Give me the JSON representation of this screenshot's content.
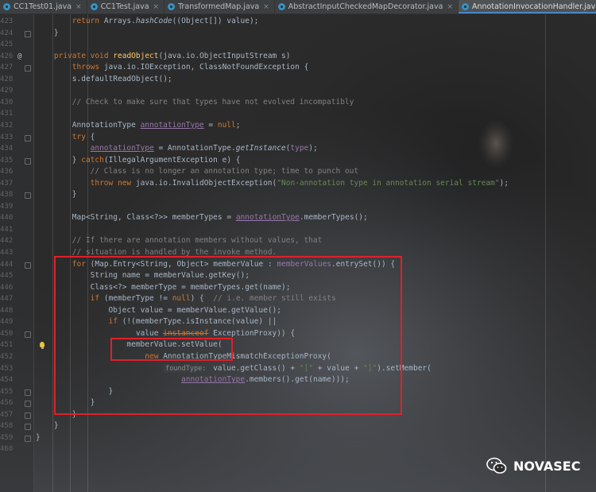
{
  "tabs": [
    {
      "label": "CC1Test01.java",
      "icon": "class-icon"
    },
    {
      "label": "CC1Test.java",
      "icon": "class-icon"
    },
    {
      "label": "TransformedMap.java",
      "icon": "class-icon"
    },
    {
      "label": "AbstractInputCheckedMapDecorator.java",
      "icon": "class-icon"
    },
    {
      "label": "AnnotationInvocationHandler.java",
      "icon": "class-icon",
      "active": true
    }
  ],
  "lines": [
    {
      "n": "423",
      "t": "        return Arrays.hashCode((Object[]) value);"
    },
    {
      "n": "424",
      "t": "    }"
    },
    {
      "n": "425",
      "t": ""
    },
    {
      "n": "426",
      "t": "    private void readObject(java.io.ObjectInputStream s)",
      "mark": "@"
    },
    {
      "n": "427",
      "t": "        throws java.io.IOException, ClassNotFoundException {"
    },
    {
      "n": "428",
      "t": "        s.defaultReadObject();"
    },
    {
      "n": "429",
      "t": ""
    },
    {
      "n": "430",
      "t": "        // Check to make sure that types have not evolved incompatibly"
    },
    {
      "n": "431",
      "t": ""
    },
    {
      "n": "432",
      "t": "        AnnotationType annotationType = null;"
    },
    {
      "n": "433",
      "t": "        try {"
    },
    {
      "n": "434",
      "t": "            annotationType = AnnotationType.getInstance(type);"
    },
    {
      "n": "435",
      "t": "        } catch(IllegalArgumentException e) {"
    },
    {
      "n": "436",
      "t": "            // Class is no longer an annotation type; time to punch out"
    },
    {
      "n": "437",
      "t": "            throw new java.io.InvalidObjectException(\"Non-annotation type in annotation serial stream\");"
    },
    {
      "n": "438",
      "t": "        }"
    },
    {
      "n": "439",
      "t": ""
    },
    {
      "n": "440",
      "t": "        Map<String, Class<?>> memberTypes = annotationType.memberTypes();"
    },
    {
      "n": "441",
      "t": ""
    },
    {
      "n": "442",
      "t": "        // If there are annotation members without values, that"
    },
    {
      "n": "443",
      "t": "        // situation is handled by the invoke method."
    },
    {
      "n": "444",
      "t": "        for (Map.Entry<String, Object> memberValue : memberValues.entrySet()) {"
    },
    {
      "n": "445",
      "t": "            String name = memberValue.getKey();"
    },
    {
      "n": "446",
      "t": "            Class<?> memberType = memberTypes.get(name);"
    },
    {
      "n": "447",
      "t": "            if (memberType != null) {  // i.e. member still exists"
    },
    {
      "n": "448",
      "t": "                Object value = memberValue.getValue();"
    },
    {
      "n": "449",
      "t": "                if (!(memberType.isInstance(value) ||"
    },
    {
      "n": "450",
      "t": "                      value instanceof ExceptionProxy)) {"
    },
    {
      "n": "451",
      "t": "                    memberValue.setValue(",
      "bulb": true
    },
    {
      "n": "452",
      "t": "                        new AnnotationTypeMismatchExceptionProxy("
    },
    {
      "n": "453",
      "t": "                            foundType: value.getClass() + \"[\" + value + \"]\").setMember("
    },
    {
      "n": "454",
      "t": "                                annotationType.members().get(name)));"
    },
    {
      "n": "455",
      "t": "                }"
    },
    {
      "n": "456",
      "t": "            }"
    },
    {
      "n": "457",
      "t": "        }"
    },
    {
      "n": "458",
      "t": "    }"
    },
    {
      "n": "459",
      "t": "}"
    },
    {
      "n": "460",
      "t": ""
    }
  ],
  "watermark": {
    "text": "NOVASEC",
    "icon": "wechat-icon"
  },
  "colors": {
    "annotation_box": "#e0202a",
    "keyword": "#cc7832",
    "method": "#ffc66d",
    "comment": "#808080",
    "string": "#6a8759",
    "field": "#9876aa"
  }
}
